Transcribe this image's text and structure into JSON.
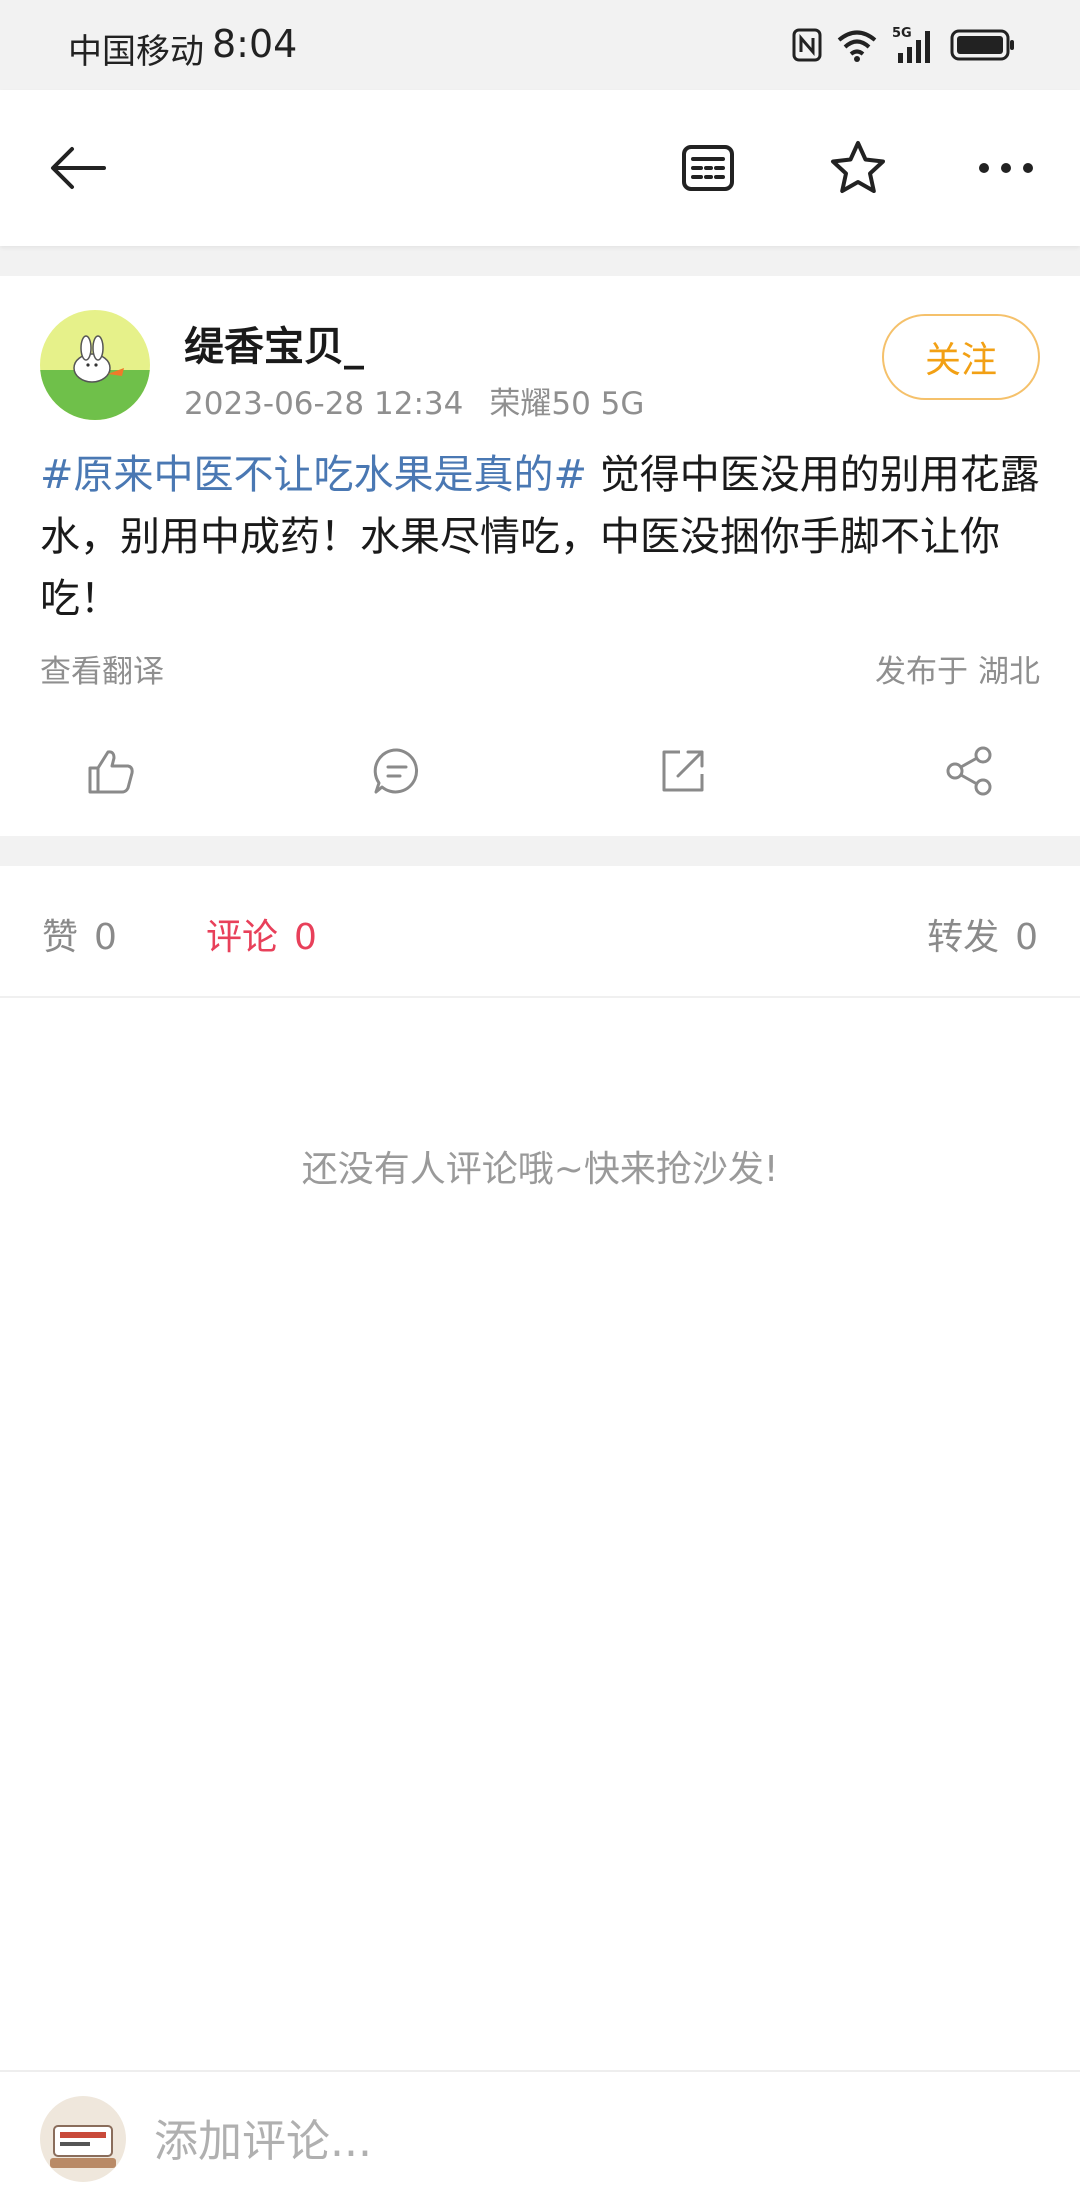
{
  "status_bar": {
    "carrier": "中国移动",
    "time": "8:04",
    "network": "5G"
  },
  "nav": {
    "icons": [
      "back-arrow-icon",
      "reader-mode-icon",
      "star-icon",
      "more-icon"
    ]
  },
  "post": {
    "username": "缇香宝贝_",
    "timestamp": "2023-06-28 12:34",
    "device": "荣耀50 5G",
    "follow_label": "关注",
    "hashtag": "#原来中医不让吃水果是真的#",
    "body": " 觉得中医没用的别用花露水，别用中成药！水果尽情吃，中医没捆你手脚不让你吃！",
    "translate_label": "查看翻译",
    "location_prefix": "发布于",
    "location": "湖北",
    "hashtag_color": "#4a78b3"
  },
  "stats": {
    "like_label": "赞",
    "like_count": "0",
    "comment_label": "评论",
    "comment_count": "0",
    "repost_label": "转发",
    "repost_count": "0",
    "active_color": "#e8405a"
  },
  "comments": {
    "empty_text": "还没有人评论哦~快来抢沙发!"
  },
  "bottom_bar": {
    "placeholder": "添加评论..."
  },
  "colors": {
    "follow_accent": "#f2a014",
    "background": "#f2f2f2"
  }
}
